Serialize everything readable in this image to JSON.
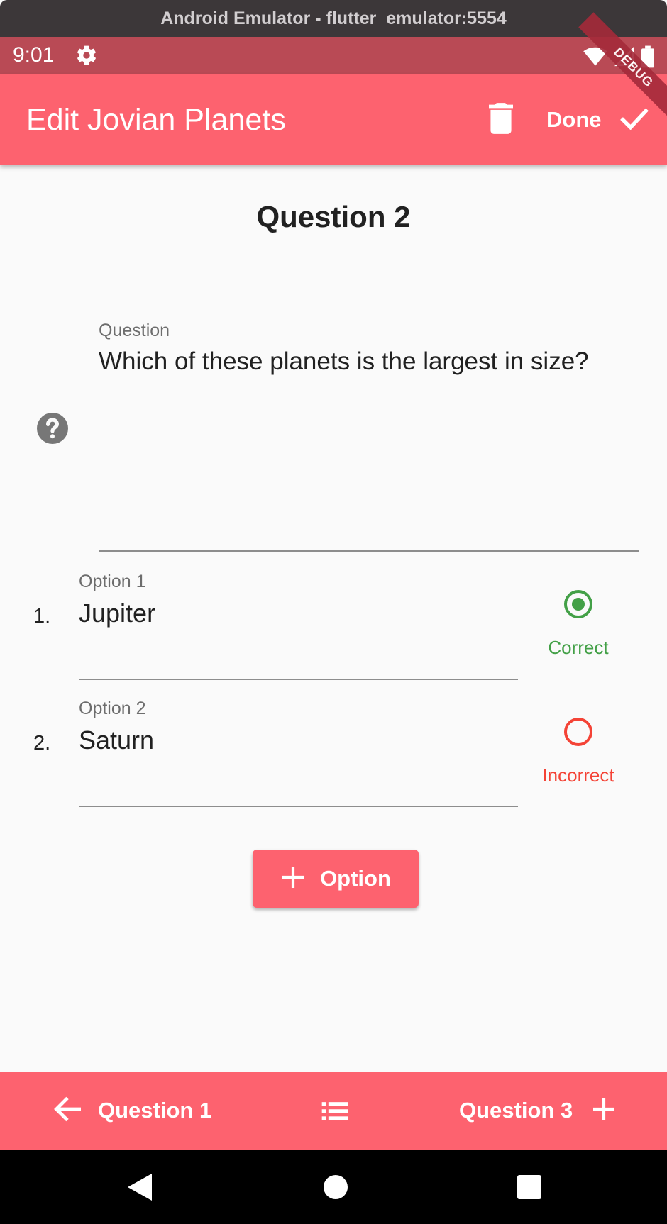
{
  "window": {
    "title": "Android Emulator - flutter_emulator:5554"
  },
  "status_bar": {
    "time": "9:01"
  },
  "debug_banner": "DEBUG",
  "app_bar": {
    "title": "Edit Jovian Planets",
    "done_label": "Done"
  },
  "heading": "Question 2",
  "question_field": {
    "label": "Question",
    "value": "Which of these planets is the largest in size?"
  },
  "options": [
    {
      "number": "1.",
      "label": "Option 1",
      "value": "Jupiter",
      "status": "Correct",
      "selected": true,
      "color": "#43a047"
    },
    {
      "number": "2.",
      "label": "Option 2",
      "value": "Saturn",
      "status": "Incorrect",
      "selected": false,
      "color": "#f44336"
    }
  ],
  "add_option_button": {
    "label": "Option"
  },
  "bottom_nav": {
    "prev_label": "Question 1",
    "next_label": "Question 3"
  },
  "colors": {
    "accent": "#fd626f",
    "status_bar": "#b94a55",
    "correct": "#43a047",
    "incorrect": "#f44336"
  }
}
